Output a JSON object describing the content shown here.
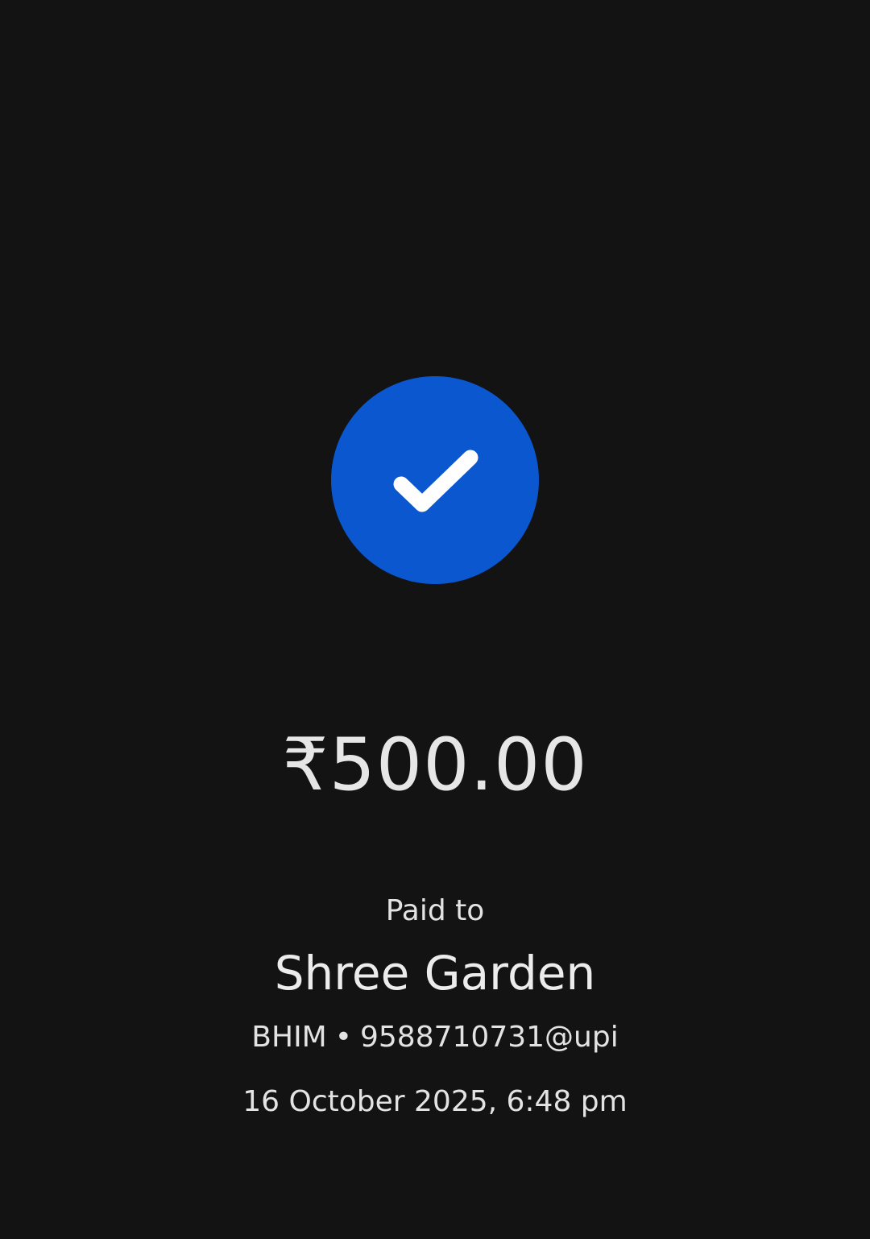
{
  "theme": {
    "background": "#131313",
    "accent": "#0b57d0",
    "text": "#e6e6e6"
  },
  "status": {
    "icon": "check-icon",
    "state": "success"
  },
  "payment": {
    "amount": "₹500.00",
    "paid_to_label": "Paid to",
    "payee_name": "Shree Garden",
    "payee_bank": "BHIM",
    "separator": "•",
    "payee_upi_id": "9588710731@upi",
    "timestamp": "16 October 2025, 6:48 pm"
  }
}
